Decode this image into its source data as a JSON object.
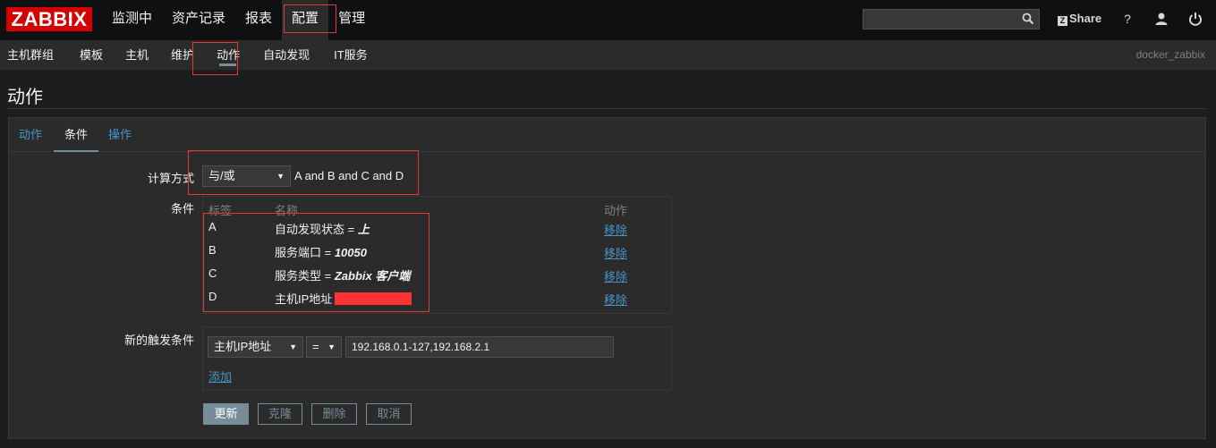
{
  "header": {
    "logo": "ZABBIX",
    "menu": [
      "监测中",
      "资产记录",
      "报表",
      "配置",
      "管理"
    ],
    "active_menu": "配置",
    "search": {
      "value": "",
      "placeholder": ""
    },
    "share_label": "Share",
    "help_label": "?"
  },
  "subnav": {
    "items": [
      "主机群组",
      "模板",
      "主机",
      "维护",
      "动作",
      "自动发现",
      "IT服务"
    ],
    "active": "动作",
    "server_name": "docker_zabbix"
  },
  "page": {
    "title": "动作"
  },
  "tabs": [
    {
      "label": "动作",
      "active": false
    },
    {
      "label": "条件",
      "active": true
    },
    {
      "label": "操作",
      "active": false
    }
  ],
  "form": {
    "calc_label": "计算方式",
    "calc_value": "与/或",
    "calc_expression": "A and B and C and D",
    "conditions_label": "条件",
    "table_headers": {
      "tag": "标签",
      "name": "名称",
      "action": "动作"
    },
    "conditions": [
      {
        "tag": "A",
        "name_prefix": "自动发现状态 = ",
        "name_value": "上",
        "remove": "移除"
      },
      {
        "tag": "B",
        "name_prefix": "服务端口 = ",
        "name_value": "10050",
        "remove": "移除"
      },
      {
        "tag": "C",
        "name_prefix": "服务类型 = ",
        "name_value": "Zabbix 客户端",
        "remove": "移除"
      },
      {
        "tag": "D",
        "name_prefix": "主机IP地址 = ",
        "name_value": "",
        "remove": "移除"
      }
    ],
    "new_condition_label": "新的触发条件",
    "new_condition": {
      "type": "主机IP地址",
      "operator": "=",
      "value": "192.168.0.1-127,192.168.2.1",
      "add_link": "添加"
    },
    "buttons": {
      "update": "更新",
      "clone": "克隆",
      "delete": "删除",
      "cancel": "取消"
    }
  },
  "colors": {
    "highlight_box": "#e53935",
    "link": "#4796c4",
    "accent": "#768d99",
    "logo_bg": "#d40000"
  }
}
